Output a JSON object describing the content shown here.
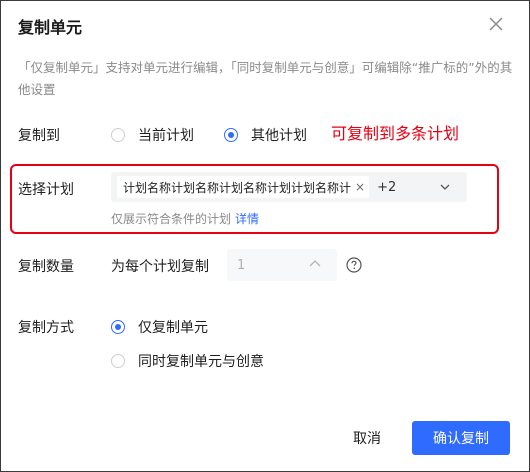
{
  "dialog": {
    "title": "复制单元",
    "description": "「仅复制单元」支持对单元进行编辑，「同时复制单元与创意」可编辑除“推广标的”外的其他设置"
  },
  "copy_to": {
    "label": "复制到",
    "options": [
      {
        "label": "当前计划",
        "selected": false
      },
      {
        "label": "其他计划",
        "selected": true
      }
    ],
    "annotation": "可复制到多条计划"
  },
  "select_plan": {
    "label": "选择计划",
    "tag": "计划名称计划名称计划名称计划计划名称计",
    "more_count": "+2",
    "hint": "仅展示符合条件的计划",
    "hint_link": "详情"
  },
  "copy_count": {
    "label": "复制数量",
    "prefix": "为每个计划复制",
    "value": "1"
  },
  "copy_method": {
    "label": "复制方式",
    "options": [
      {
        "label": "仅复制单元",
        "selected": true
      },
      {
        "label": "同时复制单元与创意",
        "selected": false
      }
    ]
  },
  "footer": {
    "cancel_label": "取消",
    "confirm_label": "确认复制"
  },
  "colors": {
    "accent": "#2f6bff",
    "annotation": "#e60012"
  },
  "icons": {
    "close": "close-icon",
    "chevron": "chevron-down-icon",
    "stepper_up": "chevron-up-icon",
    "help": "question-circle-icon"
  }
}
